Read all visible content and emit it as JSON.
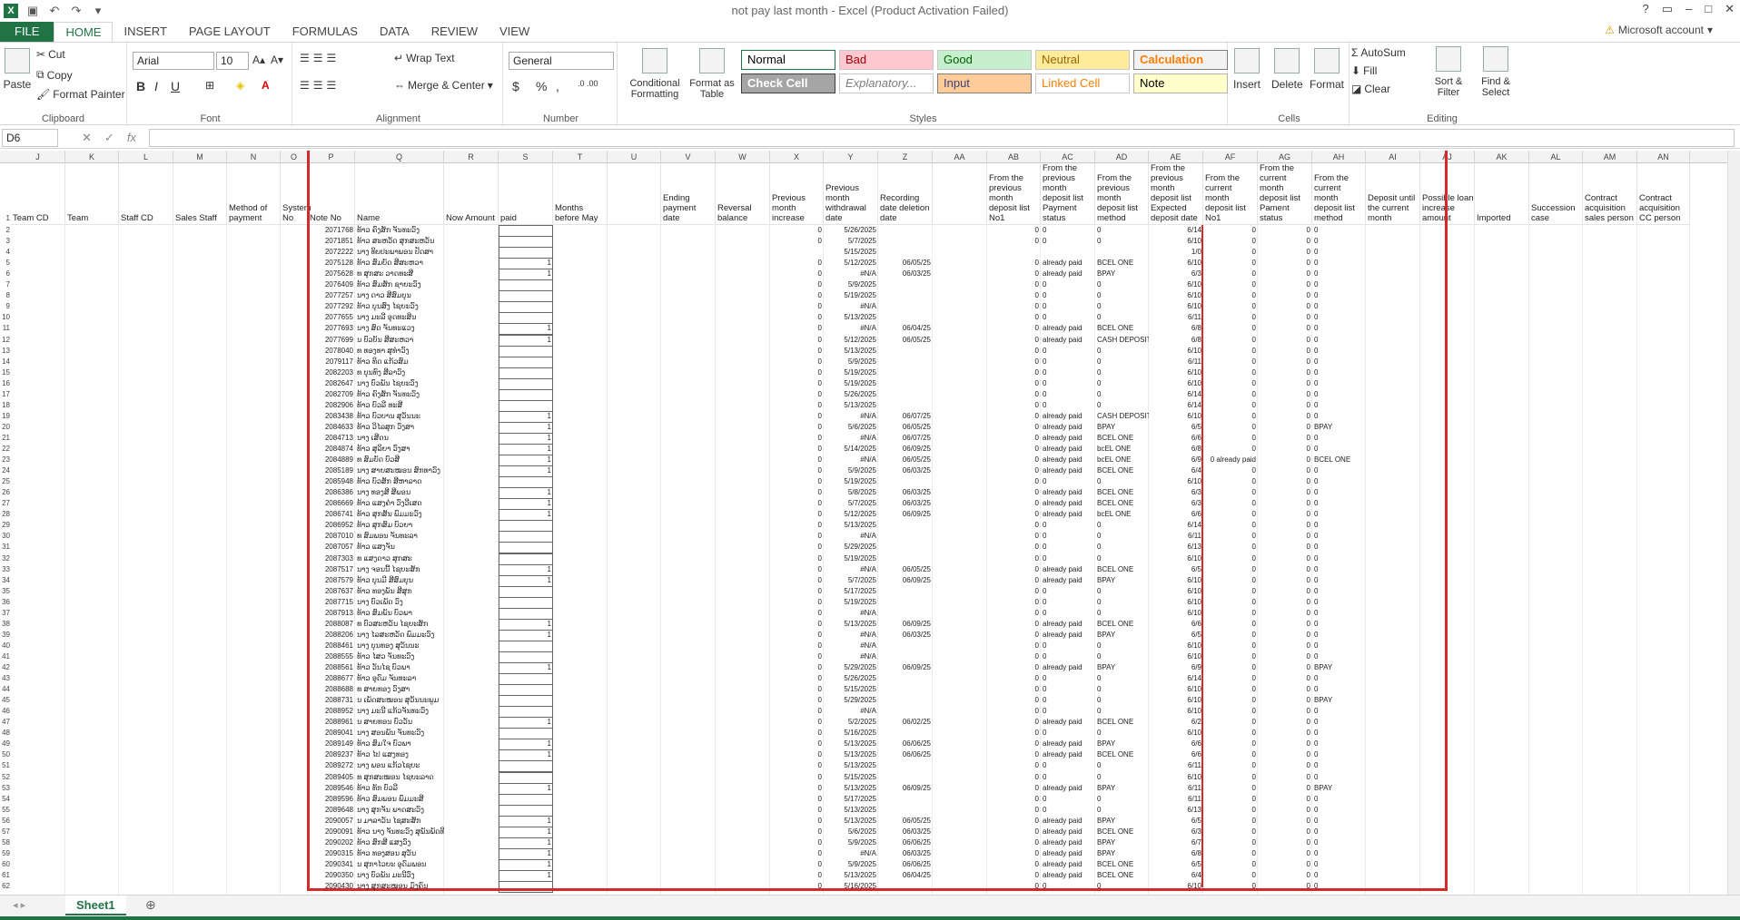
{
  "window": {
    "title": "not pay last month - Excel (Product Activation Failed)",
    "account": "Microsoft account"
  },
  "tabs": [
    "FILE",
    "HOME",
    "INSERT",
    "PAGE LAYOUT",
    "FORMULAS",
    "DATA",
    "REVIEW",
    "VIEW"
  ],
  "ribbon": {
    "clipboard": {
      "paste": "Paste",
      "cut": "Cut",
      "copy": "Copy",
      "format_painter": "Format Painter",
      "label": "Clipboard"
    },
    "font": {
      "name": "Arial",
      "size": "10",
      "label": "Font",
      "bold": "B",
      "italic": "I",
      "underline": "U"
    },
    "alignment": {
      "wrap": "Wrap Text",
      "merge": "Merge & Center",
      "label": "Alignment"
    },
    "number": {
      "format": "General",
      "label": "Number",
      "currency": "$",
      "percent": "%",
      "comma": ","
    },
    "styles": {
      "conditional": "Conditional Formatting",
      "format_table": "Format as Table",
      "label": "Styles",
      "cells": [
        {
          "text": "Normal",
          "bg": "#ffffff",
          "fg": "#000000",
          "border": "#217346"
        },
        {
          "text": "Bad",
          "bg": "#ffc7ce",
          "fg": "#9c0006",
          "border": "#c8c8c8"
        },
        {
          "text": "Good",
          "bg": "#c6efce",
          "fg": "#006100",
          "border": "#c8c8c8"
        },
        {
          "text": "Neutral",
          "bg": "#ffeb9c",
          "fg": "#9c6500",
          "border": "#c8c8c8"
        },
        {
          "text": "Calculation",
          "bg": "#f2f2f2",
          "fg": "#fa7d00",
          "border": "#7f7f7f"
        },
        {
          "text": "Check Cell",
          "bg": "#a5a5a5",
          "fg": "#ffffff",
          "border": "#3f3f3f"
        },
        {
          "text": "Explanatory...",
          "bg": "#ffffff",
          "fg": "#7f7f7f",
          "border": "#c8c8c8"
        },
        {
          "text": "Input",
          "bg": "#ffcc99",
          "fg": "#3f3f76",
          "border": "#7f7f7f"
        },
        {
          "text": "Linked Cell",
          "bg": "#ffffff",
          "fg": "#fa7d00",
          "border": "#c8c8c8"
        },
        {
          "text": "Note",
          "bg": "#ffffcc",
          "fg": "#000000",
          "border": "#b2b2b2"
        }
      ]
    },
    "cells": {
      "insert": "Insert",
      "delete": "Delete",
      "format": "Format",
      "label": "Cells"
    },
    "editing": {
      "autosum": "AutoSum",
      "fill": "Fill",
      "clear": "Clear",
      "sort": "Sort & Filter",
      "find": "Find & Select",
      "label": "Editing"
    }
  },
  "formula_bar": {
    "name_box": "D6",
    "fx": "fx",
    "value": ""
  },
  "columns": [
    "J",
    "K",
    "L",
    "M",
    "N",
    "O",
    "P",
    "Q",
    "R",
    "S",
    "T",
    "U",
    "V",
    "W",
    "X",
    "Y",
    "Z",
    "AA",
    "AB",
    "AC",
    "AD",
    "AE",
    "AF",
    "AG",
    "AH",
    "AI",
    "AJ",
    "AK",
    "AL",
    "AM",
    "AN"
  ],
  "headers": [
    "Team CD",
    "Team",
    "Staff CD",
    "Sales Staff",
    "Method of payment",
    "System No",
    "Note No",
    "Name",
    "Now Amount",
    "paid",
    "Months before May",
    "",
    "Ending payment date",
    "Reversal balance",
    "Previous month increase",
    "Previous month withdrawal date",
    "Recording date deletion date",
    "",
    "From the previous month deposit list No1",
    "From the previous month deposit list Payment status",
    "From the previous month deposit list method",
    "From the previous month deposit list Expected deposit date",
    "From the current month deposit list No1",
    "From the current month deposit list Pament status",
    "From the current month deposit list method",
    "Deposit until the current month",
    "Possible loan increase amount",
    "Imported",
    "Succession case",
    "Contract acquisition sales person",
    "Contract acquisition CC person"
  ],
  "rows": [
    [
      "2071768",
      "ທ້າວ ຄົງສັກ ຈັນທະວົງ",
      "",
      "0",
      "5/26/2025",
      "",
      "0",
      "0",
      "0",
      "6/14",
      "0",
      "0",
      "0"
    ],
    [
      "2071851",
      "ທ້າວ ສະຫວັດ ສຸກສະຫວັນ",
      "",
      "0",
      "5/7/2025",
      "",
      "0",
      "0",
      "0",
      "6/10",
      "0",
      "0",
      "0"
    ],
    [
      "2072222",
      "ນາງ ທິບປະພາພອນ ປັດສາ",
      "",
      "",
      "5/15/2025",
      "",
      "",
      "",
      "",
      "1/0",
      "0",
      "0",
      "0"
    ],
    [
      "2075128",
      "ທ້າວ ສົມບັດ ສີສະຫວາ",
      "1",
      "0",
      "5/12/2025",
      "06/05/25",
      "0",
      "already paid",
      "BCEL ONE",
      "6/10",
      "0",
      "0",
      "0"
    ],
    [
      "2075628",
      "ທ ສຸກສະ ວາດທະສີ",
      "1",
      "0",
      "#N/A",
      "06/03/25",
      "0",
      "already paid",
      "BPAY",
      "6/3",
      "0",
      "0",
      "0"
    ],
    [
      "2076409",
      "ທ້າວ ສົມສັກ ຊາຍະວົງ",
      "",
      "0",
      "5/9/2025",
      "",
      "0",
      "0",
      "0",
      "6/10",
      "0",
      "0",
      "0"
    ],
    [
      "2077257",
      "ນາງ ດາວ ສີສົມບຸນ",
      "",
      "0",
      "5/19/2025",
      "",
      "0",
      "0",
      "0",
      "6/10",
      "0",
      "0",
      "0"
    ],
    [
      "2077292",
      "ທ້າວ ບຸນສົງ ໄຊຍະວົງ",
      "",
      "0",
      "#N/A",
      "",
      "0",
      "0",
      "0",
      "6/10",
      "0",
      "0",
      "0"
    ],
    [
      "2077655",
      "ນາງ ມະລີ ອຸດທະສິນ",
      "",
      "0",
      "5/13/2025",
      "",
      "0",
      "0",
      "0",
      "6/11",
      "0",
      "0",
      "0"
    ],
    [
      "2077693",
      "ນາງ ສົດ ຈັນທະແວງ",
      "1",
      "0",
      "#N/A",
      "06/04/25",
      "0",
      "already paid",
      "BCEL ONE",
      "6/8",
      "0",
      "0",
      "0"
    ],
    [
      "2077699",
      "ນ ບົວບັນ ສີສະຫວາ",
      "1",
      "0",
      "5/12/2025",
      "06/05/25",
      "0",
      "already paid",
      "CASH DEPOSIT",
      "6/8",
      "0",
      "0",
      "0"
    ],
    [
      "2078040",
      "ທ ທອງທາ ສຸທຳວົງ",
      "",
      "0",
      "5/13/2025",
      "",
      "0",
      "0",
      "0",
      "6/10",
      "0",
      "0",
      "0"
    ],
    [
      "2079117",
      "ທ້າວ ທິດ ແກ້ວສົມ",
      "",
      "0",
      "5/9/2025",
      "",
      "0",
      "0",
      "0",
      "6/11",
      "0",
      "0",
      "0"
    ],
    [
      "2082203",
      "ທ ບຸນທົງ ສີລາວົງ",
      "",
      "0",
      "5/19/2025",
      "",
      "0",
      "0",
      "0",
      "6/10",
      "0",
      "0",
      "0"
    ],
    [
      "2082647",
      "ນາງ ບົວພັນ ໄຊຍະວົງ",
      "",
      "0",
      "5/19/2025",
      "",
      "0",
      "0",
      "0",
      "6/10",
      "0",
      "0",
      "0"
    ],
    [
      "2082709",
      "ທ້າວ ຄົງສັກ ຈັນທະວົງ",
      "",
      "0",
      "5/26/2025",
      "",
      "0",
      "0",
      "0",
      "6/14",
      "0",
      "0",
      "0"
    ],
    [
      "2082906",
      "ທ້າວ ບົວລີ ທະສີ",
      "",
      "0",
      "5/13/2025",
      "",
      "0",
      "0",
      "0",
      "6/14",
      "0",
      "0",
      "0"
    ],
    [
      "2083438",
      "ທ້າວ ບົວບານ ສຸວັນນະ",
      "1",
      "0",
      "#N/A",
      "06/07/25",
      "0",
      "already paid",
      "CASH DEPOSIT",
      "6/10",
      "0",
      "0",
      "0"
    ],
    [
      "2084633",
      "ທ້າວ ວິໄລສຸກ ວົງສາ",
      "1",
      "0",
      "5/6/2025",
      "06/05/25",
      "0",
      "already paid",
      "BPAY",
      "6/5",
      "0",
      "0",
      "BPAY"
    ],
    [
      "2084713",
      "ນາງ ເສີດນ",
      "1",
      "0",
      "#N/A",
      "06/07/25",
      "0",
      "already paid",
      "BCEL ONE",
      "6/6",
      "0",
      "0",
      "0"
    ],
    [
      "2084874",
      "ທ້າວ ສຸລິຍາ ວົງສາ",
      "1",
      "0",
      "5/14/2025",
      "06/09/25",
      "0",
      "already paid",
      "bcEL ONE",
      "6/8",
      "0",
      "0",
      "0"
    ],
    [
      "2084889",
      "ທ ສົມບັດ ບົວສີ",
      "1",
      "0",
      "#N/A",
      "06/05/25",
      "0",
      "already paid",
      "bcEL ONE",
      "6/9",
      "0 already paid",
      "0",
      "BCEL ONE"
    ],
    [
      "2085189",
      "ນາງ ສາຍສະໝອນ ສົກທາວົງ",
      "1",
      "0",
      "5/9/2025",
      "06/03/25",
      "0",
      "already paid",
      "BCEL ONE",
      "6/4",
      "0",
      "0",
      "0"
    ],
    [
      "2085948",
      "ທ້າວ ບົວສັກ ສີຫາລາດ",
      "",
      "0",
      "5/19/2025",
      "",
      "0",
      "0",
      "0",
      "6/10",
      "0",
      "0",
      "0"
    ],
    [
      "2086386",
      "ນາງ ທອງສີ ສີພອນ",
      "1",
      "0",
      "5/8/2025",
      "06/03/25",
      "0",
      "already paid",
      "BCEL ONE",
      "6/3",
      "0",
      "0",
      "0"
    ],
    [
      "2086669",
      "ທ້າວ ແສງຄຳ ວົງວີເສດ",
      "1",
      "0",
      "5/7/2025",
      "06/03/25",
      "0",
      "already paid",
      "BCEL ONE",
      "6/3",
      "0",
      "0",
      "0"
    ],
    [
      "2086741",
      "ທ້າວ ສຸກສັນ ພົມມະວົງ",
      "1",
      "0",
      "5/12/2025",
      "06/09/25",
      "0",
      "already paid",
      "bcEL ONE",
      "6/6",
      "0",
      "0",
      "0"
    ],
    [
      "2086952",
      "ທ້າວ ສຸກສົມ ບົວຍາ",
      "",
      "0",
      "5/13/2025",
      "",
      "0",
      "0",
      "0",
      "6/14",
      "0",
      "0",
      "0"
    ],
    [
      "2087010",
      "ທ ສົມພອນ ຈັນທະລາ",
      "",
      "0",
      "#N/A",
      "",
      "0",
      "0",
      "0",
      "6/11",
      "0",
      "0",
      "0"
    ],
    [
      "2087057",
      "ທ້າວ ແສງຈັນ",
      "",
      "0",
      "5/29/2025",
      "",
      "0",
      "0",
      "0",
      "6/13",
      "0",
      "0",
      "0"
    ],
    [
      "2087303",
      "ທ ແສງດາວ ສຸກສະ",
      "",
      "0",
      "5/19/2025",
      "",
      "0",
      "0",
      "0",
      "6/10",
      "0",
      "0",
      "0"
    ],
    [
      "2087517",
      "ນາງ ຈອນນີ້ ໄຊຍະສັກ",
      "1",
      "0",
      "#N/A",
      "06/05/25",
      "0",
      "already paid",
      "BCEL ONE",
      "6/5",
      "0",
      "0",
      "0"
    ],
    [
      "2087579",
      "ທ້າວ ບຸນມີ ສີສົມບຸນ",
      "1",
      "0",
      "5/7/2025",
      "06/09/25",
      "0",
      "already paid",
      "BPAY",
      "6/10",
      "0",
      "0",
      "0"
    ],
    [
      "2087637",
      "ທ້າວ ທອງພັນ ສີສຸກ",
      "",
      "0",
      "5/17/2025",
      "",
      "0",
      "0",
      "0",
      "6/10",
      "0",
      "0",
      "0"
    ],
    [
      "2087715",
      "ນາງ ບົວເພັດ ວົງ",
      "",
      "0",
      "5/19/2025",
      "",
      "0",
      "0",
      "0",
      "6/10",
      "0",
      "0",
      "0"
    ],
    [
      "2087913",
      "ທ້າວ ສົມພັນ ບົວພາ",
      "",
      "0",
      "#N/A",
      "",
      "0",
      "0",
      "0",
      "6/10",
      "0",
      "0",
      "0"
    ],
    [
      "2088087",
      "ທ ບົວສະຫວັນ ໄຊຍະສັກ",
      "1",
      "0",
      "5/13/2025",
      "06/09/25",
      "0",
      "already paid",
      "BCEL ONE",
      "6/6",
      "0",
      "0",
      "0"
    ],
    [
      "2088206",
      "ນາງ ໄລສະຫວັດ ພົມມະວົງ",
      "1",
      "0",
      "#N/A",
      "06/03/25",
      "0",
      "already paid",
      "BPAY",
      "6/5",
      "0",
      "0",
      "0"
    ],
    [
      "2088461",
      "ນາງ ບຸນທອງ ສຸວັນນະ",
      "",
      "0",
      "#N/A",
      "",
      "0",
      "0",
      "0",
      "6/10",
      "0",
      "0",
      "0"
    ],
    [
      "2088555",
      "ທ້າວ ໄສວ ຈັນທະວົງ",
      "",
      "0",
      "#N/A",
      "",
      "0",
      "0",
      "0",
      "6/10",
      "0",
      "0",
      "0"
    ],
    [
      "2088561",
      "ທ້າວ ວັນໄຊ ບົວພາ",
      "1",
      "0",
      "5/29/2025",
      "06/09/25",
      "0",
      "already paid",
      "BPAY",
      "6/9",
      "0",
      "0",
      "BPAY"
    ],
    [
      "2088677",
      "ທ້າວ ອຸດົມ ຈັນທະລາ",
      "",
      "0",
      "5/26/2025",
      "",
      "0",
      "0",
      "0",
      "6/14",
      "0",
      "0",
      "0"
    ],
    [
      "2088688",
      "ທ ສາຍທອງ ວົງສາ",
      "",
      "0",
      "5/15/2025",
      "",
      "0",
      "0",
      "0",
      "6/10",
      "0",
      "0",
      "0"
    ],
    [
      "2088731",
      "ນ ເພັດສະໝອນ ສຸວັນນະພູມ",
      "",
      "0",
      "5/29/2025",
      "",
      "0",
      "0",
      "0",
      "6/10",
      "0",
      "0",
      "BPAY"
    ],
    [
      "2088952",
      "ນາງ ມະນີ ແກ້ວຈັນທະວົງ",
      "",
      "0",
      "#N/A",
      "",
      "0",
      "0",
      "0",
      "6/10",
      "0",
      "0",
      "0"
    ],
    [
      "2088961",
      "ນ ສາຍທອນ ບົວວັນ",
      "1",
      "0",
      "5/2/2025",
      "06/02/25",
      "0",
      "already paid",
      "BCEL ONE",
      "6/2",
      "0",
      "0",
      "0"
    ],
    [
      "2089041",
      "ນາງ ສອນພັນ ຈັນທະວົງ",
      "",
      "0",
      "5/16/2025",
      "",
      "0",
      "0",
      "0",
      "6/10",
      "0",
      "0",
      "0"
    ],
    [
      "2089149",
      "ທ້າວ ສົມໃຈ ບົວພາ",
      "1",
      "0",
      "5/13/2025",
      "06/06/25",
      "0",
      "already paid",
      "BPAY",
      "6/6",
      "0",
      "0",
      "0"
    ],
    [
      "2089237",
      "ທ້າວ ໄປ ແສງທອງ",
      "1",
      "0",
      "5/13/2025",
      "06/06/25",
      "0",
      "already paid",
      "BCEL ONE",
      "6/6",
      "0",
      "0",
      "0"
    ],
    [
      "2089272",
      "ນາງ ພອນ ແກ້ວໄຊຍະ",
      "",
      "0",
      "5/13/2025",
      "",
      "0",
      "0",
      "0",
      "6/11",
      "0",
      "0",
      "0"
    ],
    [
      "2089405",
      "ທ ສຸກສະໝອນ ໄຊຍະລາດ",
      "",
      "0",
      "5/15/2025",
      "",
      "0",
      "0",
      "0",
      "6/10",
      "0",
      "0",
      "0"
    ],
    [
      "2089546",
      "ທ້າວ ທັກ ບົວລີ",
      "1",
      "0",
      "5/13/2025",
      "06/09/25",
      "0",
      "already paid",
      "BPAY",
      "6/11",
      "0",
      "0",
      "BPAY"
    ],
    [
      "2089596",
      "ທ້າວ ສົມພອນ ພົມມະສີ",
      "",
      "0",
      "5/17/2025",
      "",
      "0",
      "0",
      "0",
      "6/11",
      "0",
      "0",
      "0"
    ],
    [
      "2089648",
      "ນາງ ສຸກຈັນ ພາດສະວົງ",
      "",
      "0",
      "5/13/2025",
      "",
      "0",
      "0",
      "0",
      "6/13",
      "0",
      "0",
      "0"
    ],
    [
      "2090057",
      "ນ ມາລາວັນ ໄຊສະສັກ",
      "1",
      "0",
      "5/13/2025",
      "06/05/25",
      "0",
      "already paid",
      "BPAY",
      "6/5",
      "0",
      "0",
      "0"
    ],
    [
      "2090091",
      "ທ້າວ ນາງ ຈັນທະວົງ ສຸພັນພັດທີ",
      "1",
      "0",
      "5/6/2025",
      "06/03/25",
      "0",
      "already paid",
      "BCEL ONE",
      "6/3",
      "0",
      "0",
      "0"
    ],
    [
      "2090202",
      "ທ້າວ ສົກສີ ແສງວົງ",
      "1",
      "0",
      "5/9/2025",
      "06/06/25",
      "0",
      "already paid",
      "BPAY",
      "6/7",
      "0",
      "0",
      "0"
    ],
    [
      "2090315",
      "ທ້າວ ທອງສອນ ສຸວັນ",
      "1",
      "0",
      "#N/A",
      "06/03/25",
      "0",
      "already paid",
      "BPAY",
      "6/8",
      "0",
      "0",
      "0"
    ],
    [
      "2090341",
      "ນ ສຸກາໄວຍະ ອຸດົມພອນ",
      "1",
      "0",
      "5/9/2025",
      "06/06/25",
      "0",
      "already paid",
      "BCEL ONE",
      "6/5",
      "0",
      "0",
      "0"
    ],
    [
      "2090350",
      "ນາງ ບົວພັນ ມະນີວົງ",
      "1",
      "0",
      "5/13/2025",
      "06/04/25",
      "0",
      "already paid",
      "BCEL ONE",
      "6/4",
      "0",
      "0",
      "0"
    ],
    [
      "2090430",
      "ນາງ ສຸກສະໝອນ ມົງຄົນ",
      "",
      "0",
      "5/16/2025",
      "",
      "0",
      "0",
      "0",
      "6/10",
      "0",
      "0",
      "0"
    ]
  ],
  "sheet": {
    "name": "Sheet1"
  }
}
